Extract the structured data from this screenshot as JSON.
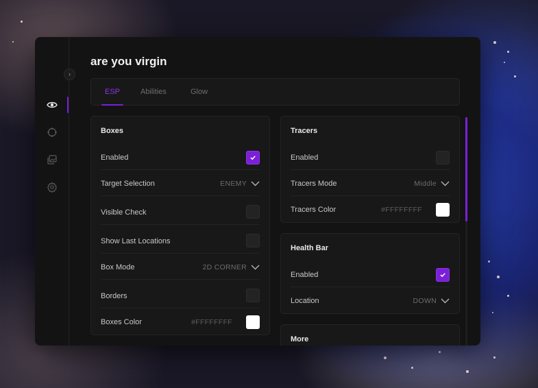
{
  "window": {
    "title": "are you virgin"
  },
  "tabs": [
    {
      "label": "ESP",
      "active": true
    },
    {
      "label": "Abilities",
      "active": false
    },
    {
      "label": "Glow",
      "active": false
    }
  ],
  "sidebar": {
    "items": [
      {
        "icon": "eye-icon",
        "active": true
      },
      {
        "icon": "crosshair-icon",
        "active": false
      },
      {
        "icon": "gallery-icon",
        "active": false
      },
      {
        "icon": "gear-icon",
        "active": false
      }
    ]
  },
  "panels": {
    "boxes": {
      "title": "Boxes",
      "enabled_label": "Enabled",
      "enabled": true,
      "target_selection_label": "Target Selection",
      "target_selection_value": "ENEMY",
      "visible_check_label": "Visible Check",
      "visible_check": false,
      "show_last_locations_label": "Show Last Locations",
      "show_last_locations": false,
      "box_mode_label": "Box Mode",
      "box_mode_value": "2D CORNER",
      "borders_label": "Borders",
      "borders": false,
      "boxes_color_label": "Boxes Color",
      "boxes_color_hex": "#FFFFFFFF"
    },
    "tracers": {
      "title": "Tracers",
      "enabled_label": "Enabled",
      "enabled": false,
      "mode_label": "Tracers Mode",
      "mode_value": "Middle",
      "color_label": "Tracers Color",
      "color_hex": "#FFFFFFFF"
    },
    "health_bar": {
      "title": "Health Bar",
      "enabled_label": "Enabled",
      "enabled": true,
      "location_label": "Location",
      "location_value": "DOWN"
    },
    "more": {
      "title": "More"
    }
  },
  "colors": {
    "accent": "#7b1fd8",
    "window_bg": "#131313",
    "panel_bg": "#181818",
    "swatch": "#ffffff"
  }
}
